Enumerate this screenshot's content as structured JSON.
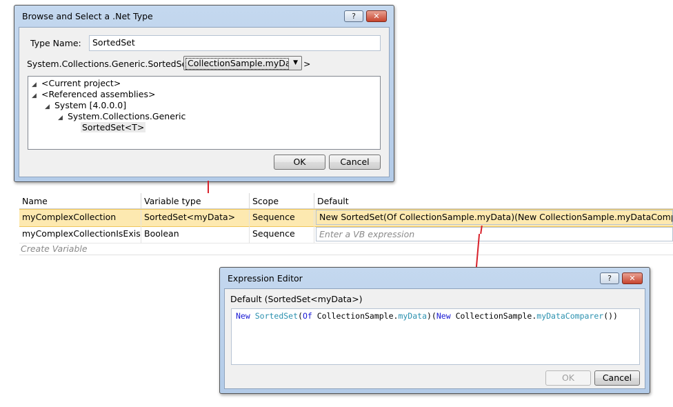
{
  "browse_dialog": {
    "title": "Browse and Select a .Net Type",
    "help_label": "?",
    "close_label": "✕",
    "type_name_label": "Type Name:",
    "type_name_value": "SortedSet",
    "generic_prefix": "System.Collections.Generic.SortedSet <",
    "generic_suffix": ">",
    "type_arg_selected": "CollectionSample.myData",
    "tree": [
      {
        "label": "<Current project>",
        "expander": "◢"
      },
      {
        "label": "<Referenced assemblies>",
        "expander": "◢"
      },
      {
        "label": "System [4.0.0.0]",
        "expander": "◢"
      },
      {
        "label": "System.Collections.Generic",
        "expander": "◢"
      },
      {
        "label": "SortedSet<T>",
        "expander": ""
      }
    ],
    "ok_label": "OK",
    "cancel_label": "Cancel"
  },
  "variables_grid": {
    "headers": [
      "Name",
      "Variable type",
      "Scope",
      "Default"
    ],
    "rows": [
      {
        "name": "myComplexCollection",
        "type": "SortedSet<myData>",
        "scope": "Sequence",
        "default": "New SortedSet(Of CollectionSample.myData)(New CollectionSample.myDataComparer())"
      },
      {
        "name": "myComplexCollectionIsExists",
        "type": "Boolean",
        "scope": "Sequence",
        "default_placeholder": "Enter a VB expression"
      }
    ],
    "create_variable": "Create Variable"
  },
  "expression_editor": {
    "title": "Expression Editor",
    "help_label": "?",
    "close_label": "✕",
    "caption": "Default (SortedSet<myData>)",
    "code_tokens": {
      "t1": "New",
      "t2": "SortedSet",
      "t3": "(",
      "t4": "Of",
      "t5": " CollectionSample.",
      "t6": "myData",
      "t7": ")(",
      "t8": "New",
      "t9": " CollectionSample.",
      "t10": "myDataComparer",
      "t11": "())"
    },
    "ok_label": "OK",
    "cancel_label": "Cancel"
  },
  "colors": {
    "selected_row": "#fde9b0",
    "connector": "#d8202a",
    "keyword": "#1a1ad4",
    "type": "#2b91af"
  }
}
